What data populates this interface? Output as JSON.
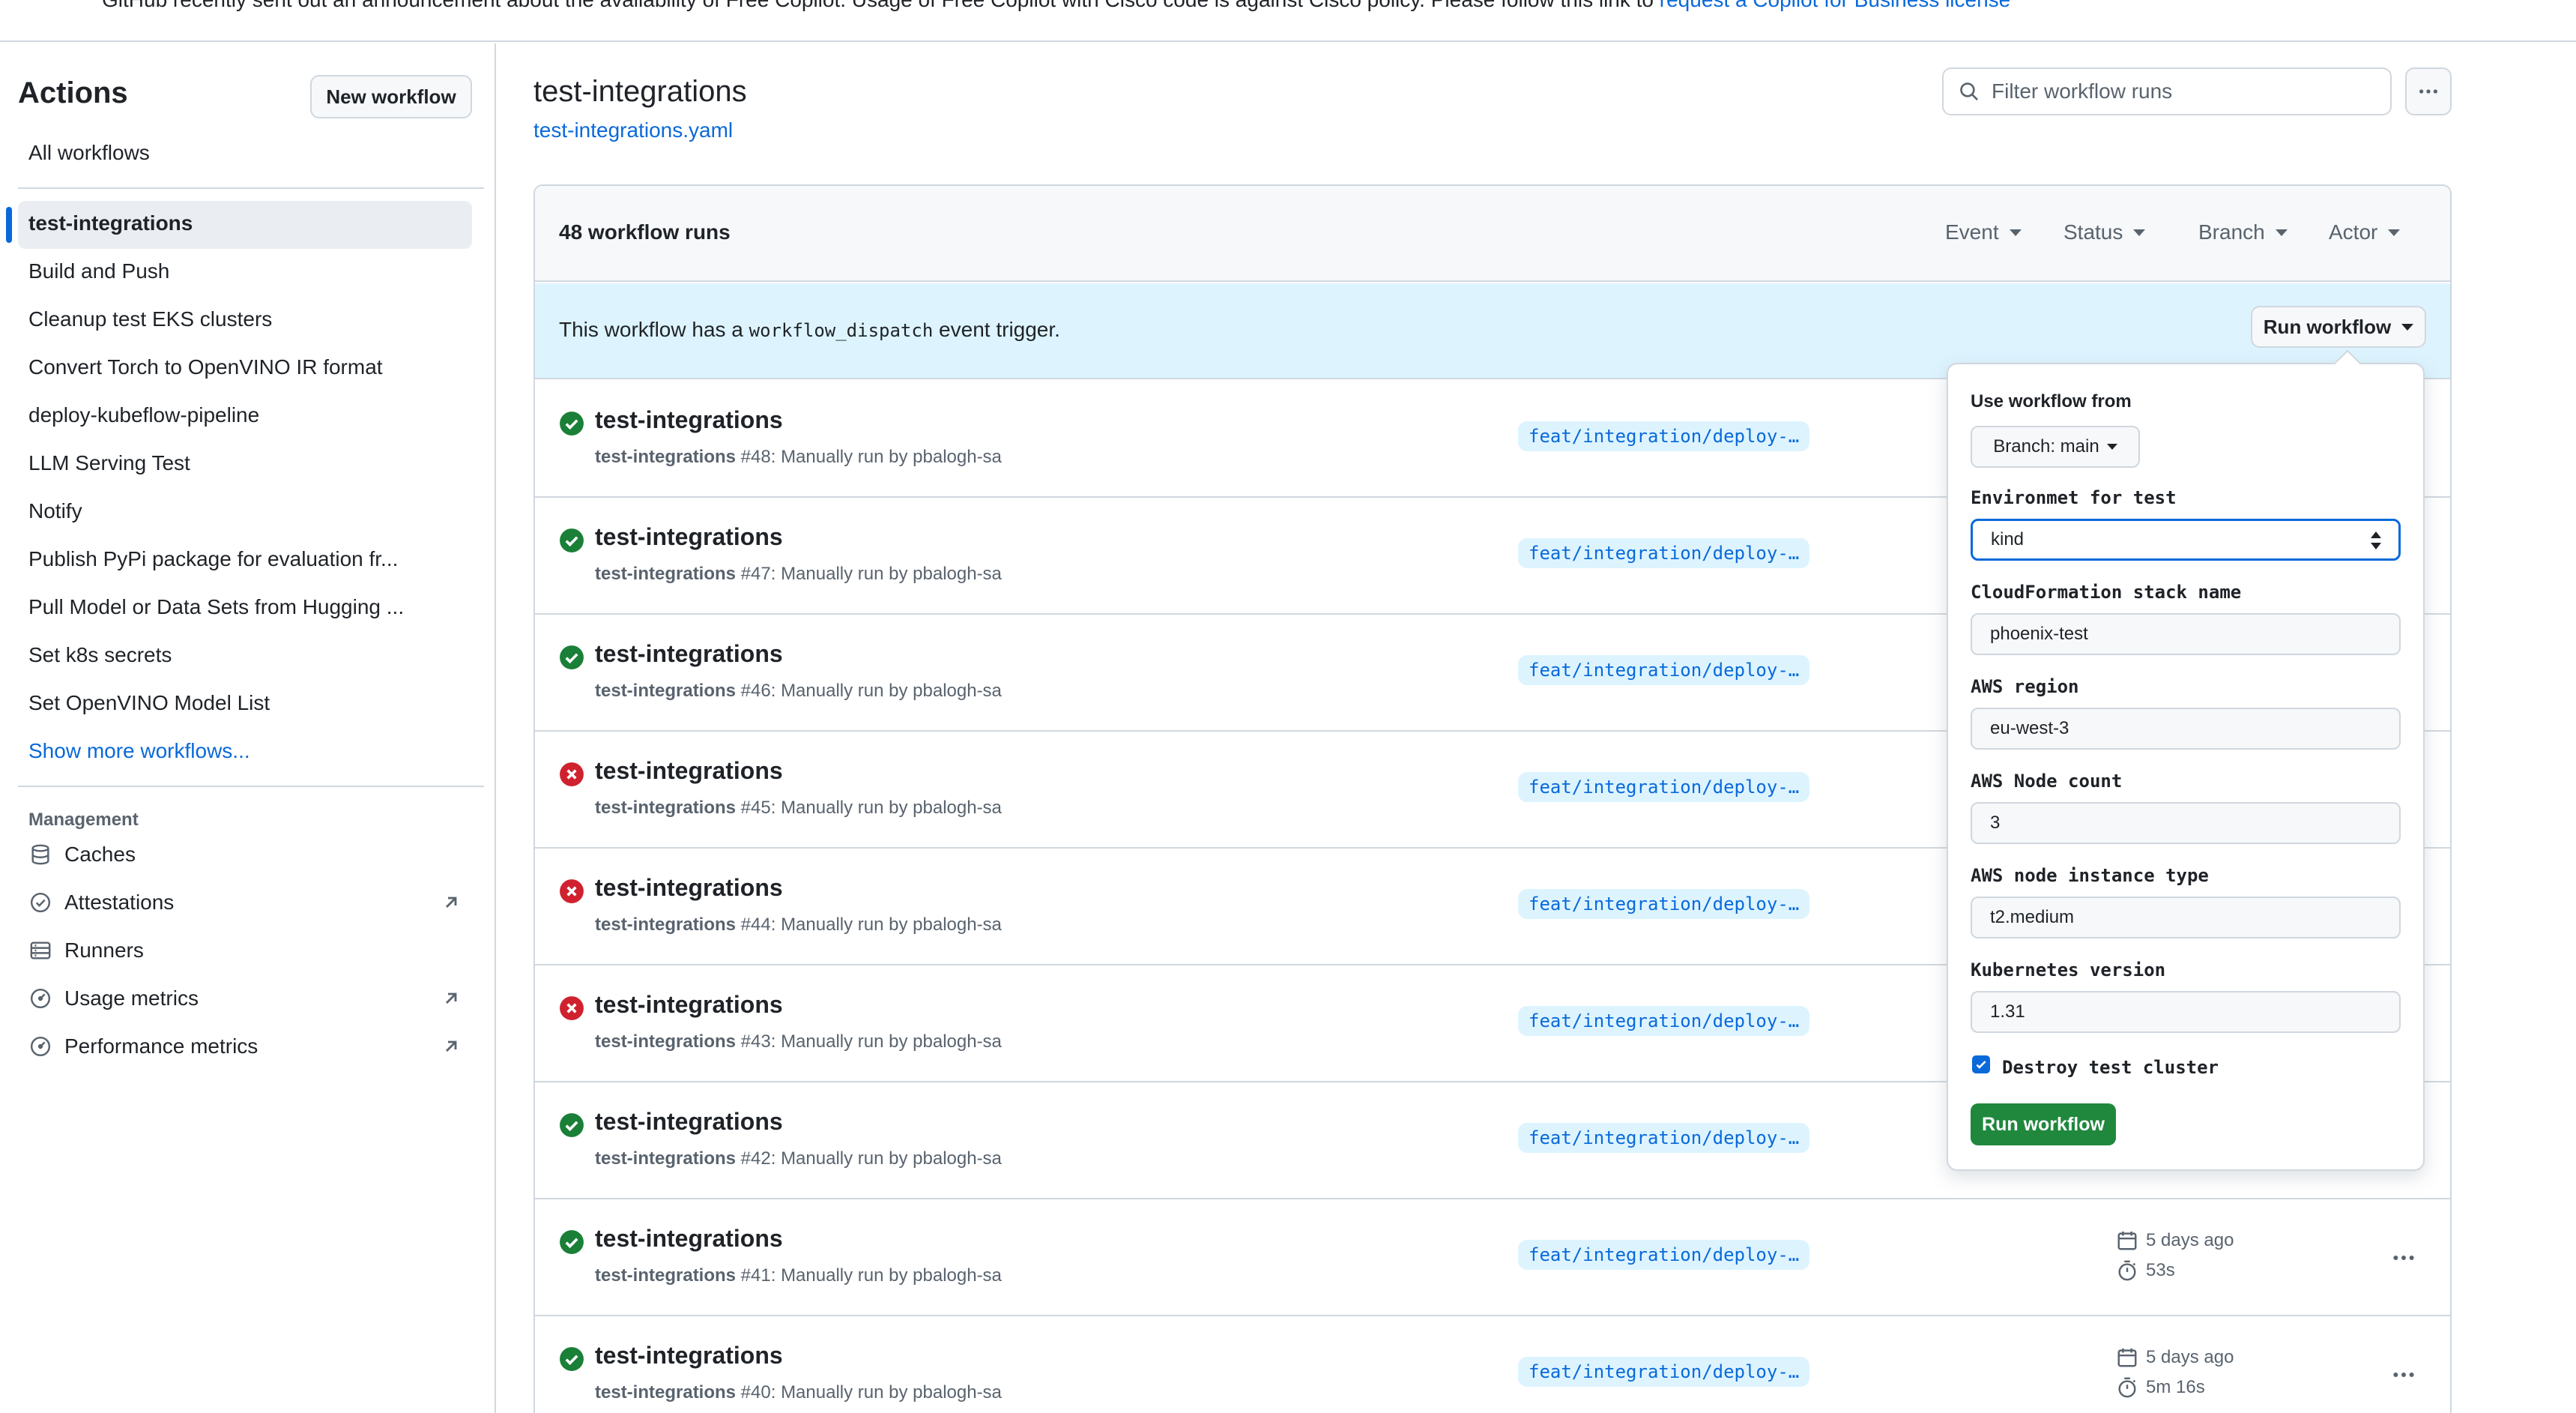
{
  "banner": {
    "text": "GitHub recently sent out an announcement about the availability of Free Copilot. Usage of Free Copilot with Cisco code is against Cisco policy. Please follow this link to ",
    "link": "request a Copilot for Business license"
  },
  "sidebar": {
    "title": "Actions",
    "new_workflow": "New workflow",
    "all_workflows": "All workflows",
    "workflows": [
      "test-integrations",
      "Build and Push",
      "Cleanup test EKS clusters",
      "Convert Torch to OpenVINO IR format",
      "deploy-kubeflow-pipeline",
      "LLM Serving Test",
      "Notify",
      "Publish PyPi package for evaluation fr...",
      "Pull Model or Data Sets from Hugging ...",
      "Set k8s secrets",
      "Set OpenVINO Model List"
    ],
    "show_more": "Show more workflows...",
    "management_title": "Management",
    "management": [
      "Caches",
      "Attestations",
      "Runners",
      "Usage metrics",
      "Performance metrics"
    ]
  },
  "main": {
    "title": "test-integrations",
    "file": "test-integrations.yaml",
    "filter_placeholder": "Filter workflow runs",
    "runs_count": "48 workflow runs",
    "filters": [
      "Event",
      "Status",
      "Branch",
      "Actor"
    ],
    "dispatch_prefix": "This workflow has a ",
    "dispatch_code": "workflow_dispatch",
    "dispatch_suffix": " event trigger.",
    "run_workflow": "Run workflow"
  },
  "runs": [
    {
      "title": "test-integrations",
      "name": "test-integrations",
      "num": " #48: Manually run by pbalogh-sa",
      "branch": "feat/integration/deploy-…",
      "status": "success"
    },
    {
      "title": "test-integrations",
      "name": "test-integrations",
      "num": " #47: Manually run by pbalogh-sa",
      "branch": "feat/integration/deploy-…",
      "status": "success"
    },
    {
      "title": "test-integrations",
      "name": "test-integrations",
      "num": " #46: Manually run by pbalogh-sa",
      "branch": "feat/integration/deploy-…",
      "status": "success"
    },
    {
      "title": "test-integrations",
      "name": "test-integrations",
      "num": " #45: Manually run by pbalogh-sa",
      "branch": "feat/integration/deploy-…",
      "status": "failure"
    },
    {
      "title": "test-integrations",
      "name": "test-integrations",
      "num": " #44: Manually run by pbalogh-sa",
      "branch": "feat/integration/deploy-…",
      "status": "failure"
    },
    {
      "title": "test-integrations",
      "name": "test-integrations",
      "num": " #43: Manually run by pbalogh-sa",
      "branch": "feat/integration/deploy-…",
      "status": "failure"
    },
    {
      "title": "test-integrations",
      "name": "test-integrations",
      "num": " #42: Manually run by pbalogh-sa",
      "branch": "feat/integration/deploy-…",
      "status": "success"
    },
    {
      "title": "test-integrations",
      "name": "test-integrations",
      "num": " #41: Manually run by pbalogh-sa",
      "branch": "feat/integration/deploy-…",
      "status": "success",
      "date": "5 days ago",
      "duration": "53s"
    },
    {
      "title": "test-integrations",
      "name": "test-integrations",
      "num": " #40: Manually run by pbalogh-sa",
      "branch": "feat/integration/deploy-…",
      "status": "success",
      "date": "5 days ago",
      "duration": "5m 16s"
    }
  ],
  "dropdown": {
    "use_from": "Use workflow from",
    "branch": "Branch: main",
    "fields": [
      {
        "label": "Environmet for test",
        "value": "kind"
      },
      {
        "label": "CloudFormation stack name",
        "value": "phoenix-test"
      },
      {
        "label": "AWS region",
        "value": "eu-west-3"
      },
      {
        "label": "AWS Node count",
        "value": "3"
      },
      {
        "label": "AWS node instance type",
        "value": "t2.medium"
      },
      {
        "label": "Kubernetes version",
        "value": "1.31"
      }
    ],
    "checkbox_label": "Destroy test cluster",
    "checkbox_checked": true,
    "submit": "Run workflow"
  },
  "colors": {
    "accent": "#0969da",
    "success": "#1a7f37",
    "failure": "#cf222e",
    "primary_button": "#1f883d"
  }
}
